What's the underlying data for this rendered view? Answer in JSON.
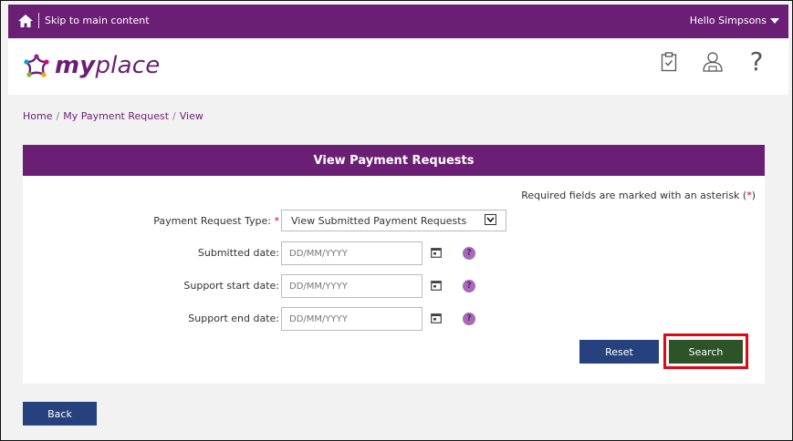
{
  "topbar": {
    "skip_link": "Skip to main content",
    "user_menu": "Hello Simpsons"
  },
  "header": {
    "logo_bold": "my",
    "logo_light": "place",
    "icons": [
      "clipboard-icon",
      "profile-icon",
      "help-icon"
    ],
    "help_glyph": "?"
  },
  "breadcrumb": {
    "items": [
      "Home",
      "My Payment Request",
      "View"
    ],
    "separator": "/"
  },
  "panel": {
    "title": "View Payment Requests",
    "required_note_prefix": "Required fields are marked with an asterisk (",
    "required_note_ast": "*",
    "required_note_suffix": ")"
  },
  "form": {
    "request_type": {
      "label": "Payment Request Type:",
      "required_mark": "*",
      "value": "View Submitted Payment Requests"
    },
    "submitted_date": {
      "label": "Submitted date:",
      "placeholder": "DD/MM/YYYY"
    },
    "support_start_date": {
      "label": "Support start date:",
      "placeholder": "DD/MM/YYYY"
    },
    "support_end_date": {
      "label": "Support end date:",
      "placeholder": "DD/MM/YYYY"
    },
    "help_glyph": "?"
  },
  "buttons": {
    "reset": "Reset",
    "search": "Search",
    "back": "Back"
  },
  "colors": {
    "brand_purple": "#6b1f74",
    "button_blue": "#26427e",
    "button_green": "#2e5329",
    "highlight_red": "#e30613",
    "required_red": "#d0021b"
  }
}
